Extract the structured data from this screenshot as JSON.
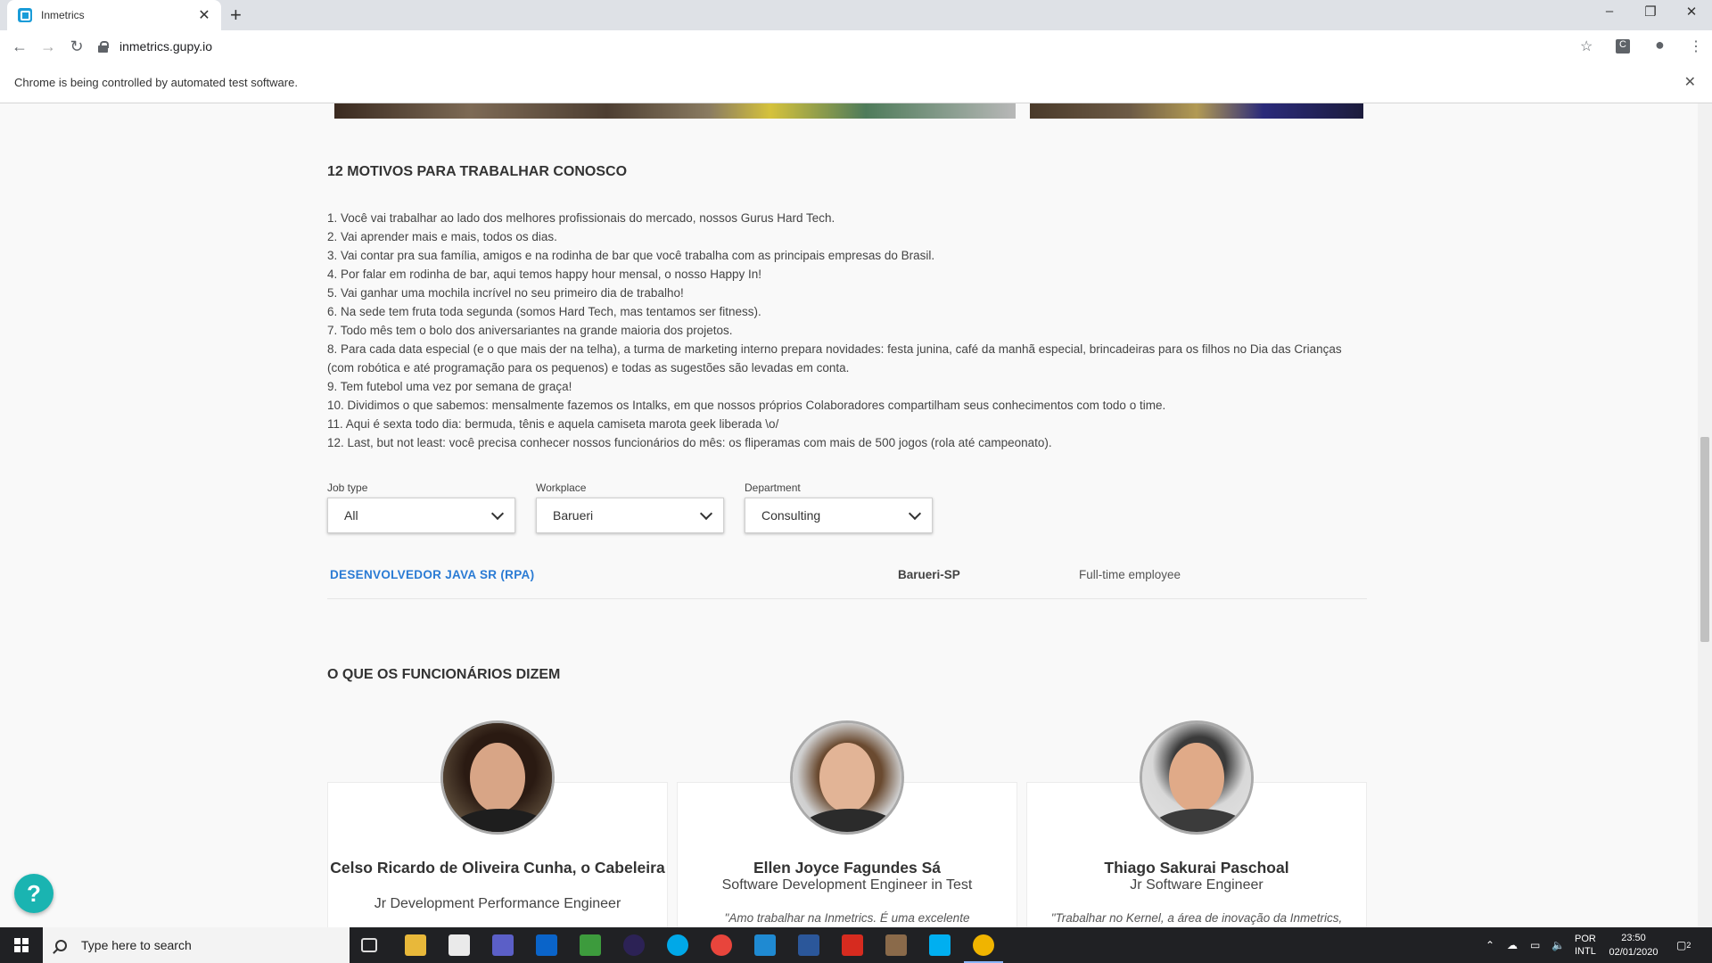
{
  "browser": {
    "tab_title": "Inmetrics",
    "url": "inmetrics.gupy.io",
    "infobar_text": "Chrome is being controlled by automated test software."
  },
  "reasons_section": {
    "title": "12 MOTIVOS PARA TRABALHAR CONOSCO",
    "items": [
      "1. Você vai trabalhar ao lado dos melhores profissionais do mercado, nossos Gurus Hard Tech.",
      "2. Vai aprender mais e mais, todos os dias.",
      "3. Vai contar pra sua família, amigos e na rodinha de bar que você trabalha com as principais empresas do Brasil.",
      "4. Por falar em rodinha de bar, aqui temos happy hour mensal, o nosso Happy In!",
      "5. Vai ganhar uma mochila incrível no seu primeiro dia de trabalho!",
      "6. Na sede tem fruta toda segunda (somos Hard Tech, mas tentamos ser fitness).",
      "7. Todo mês tem o bolo dos aniversariantes na grande maioria dos projetos.",
      "8. Para cada data especial (e o que mais der na telha), a turma de marketing interno prepara novidades: festa junina, café da manhã especial, brincadeiras para os filhos no Dia das Crianças (com robótica e até programação para os pequenos) e todas as sugestões são levadas em conta.",
      "9. Tem futebol uma vez por semana de graça!",
      "10. Dividimos o que sabemos: mensalmente fazemos os Intalks, em que nossos próprios Colaboradores compartilham seus conhecimentos com todo o time.",
      "11. Aqui é sexta todo dia: bermuda, tênis e aquela camiseta marota geek liberada \\o/",
      "12. Last, but not least: você precisa conhecer nossos funcionários do mês: os fliperamas com mais de 500 jogos (rola até campeonato)."
    ]
  },
  "filters": {
    "job_type": {
      "label": "Job type",
      "value": "All"
    },
    "workplace": {
      "label": "Workplace",
      "value": "Barueri"
    },
    "department": {
      "label": "Department",
      "value": "Consulting"
    }
  },
  "jobs": [
    {
      "title": "DESENVOLVEDOR JAVA SR (RPA)",
      "location": "Barueri-SP",
      "type": "Full-time employee"
    }
  ],
  "testimonials": {
    "title": "O QUE OS FUNCIONÁRIOS DIZEM",
    "people": [
      {
        "name": "Celso Ricardo de Oliveira Cunha, o Cabeleira",
        "role": "Jr Development Performance Engineer",
        "quote": ""
      },
      {
        "name": "Ellen Joyce Fagundes Sá",
        "role": "Software Development Engineer in Test",
        "quote": "\"Amo trabalhar na Inmetrics. É uma excelente"
      },
      {
        "name": "Thiago Sakurai Paschoal",
        "role": "Jr Software Engineer",
        "quote": "\"Trabalhar no Kernel, a área de inovação da Inmetrics,"
      }
    ]
  },
  "help_button": "?",
  "taskbar": {
    "search_placeholder": "Type here to search",
    "lang_top": "POR",
    "lang_bottom": "INTL",
    "time": "23:50",
    "date": "02/01/2020",
    "notification_count": "2"
  },
  "colors": {
    "accent_link": "#2a7bd4",
    "help_button": "#1ab4b1",
    "taskbar": "#202124"
  }
}
